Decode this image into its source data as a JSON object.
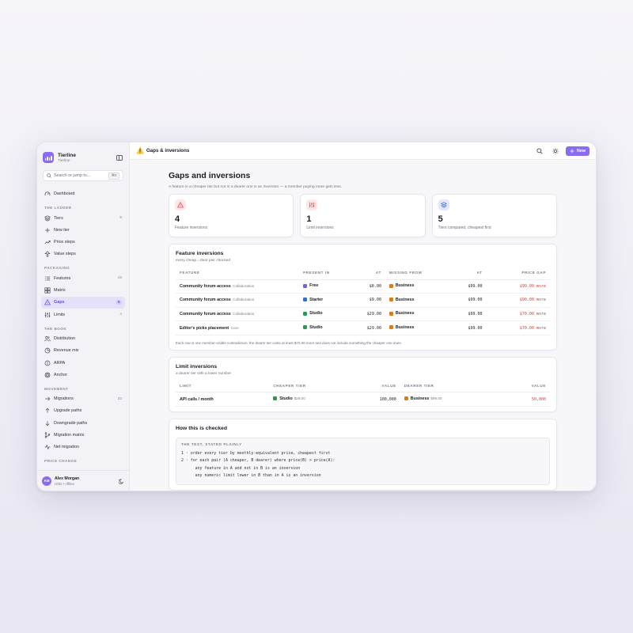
{
  "app": {
    "name": "Tierline",
    "sub": "Tierline"
  },
  "search": {
    "placeholder": "Search or jump to...",
    "shortcut": "⌘K"
  },
  "sidebar": {
    "dashboard": "Dashboard",
    "sections": {
      "ladder": "THE LADDER",
      "packaging": "PACKAGING",
      "book": "THE BOOK",
      "movement": "MOVEMENT",
      "price_change": "PRICE CHANGE"
    },
    "ladder": [
      {
        "label": "Tiers",
        "count": "5"
      },
      {
        "label": "New tier",
        "count": ""
      },
      {
        "label": "Price steps",
        "count": ""
      },
      {
        "label": "Value steps",
        "count": ""
      }
    ],
    "packaging": [
      {
        "label": "Features",
        "count": "15"
      },
      {
        "label": "Matrix",
        "count": ""
      },
      {
        "label": "Gaps",
        "count": "5"
      },
      {
        "label": "Limits",
        "count": "4"
      }
    ],
    "book": [
      {
        "label": "Distribution"
      },
      {
        "label": "Revenue mix"
      },
      {
        "label": "ARPA"
      },
      {
        "label": "Anchor"
      }
    ],
    "movement": [
      {
        "label": "Migrations",
        "count": "33"
      },
      {
        "label": "Upgrade paths",
        "count": ""
      },
      {
        "label": "Downgrade paths",
        "count": ""
      },
      {
        "label": "Migration matrix",
        "count": ""
      },
      {
        "label": "Net migration",
        "count": ""
      }
    ]
  },
  "user": {
    "initials": "AM",
    "name": "Alex Morgan",
    "sub": "USD • offline"
  },
  "topbar": {
    "breadcrumb": "Gaps & inversions",
    "new_label": "New"
  },
  "page": {
    "title": "Gaps and inversions",
    "subtitle": "A feature in a cheaper tier but not in a dearer one is an inversion — a member paying more gets less."
  },
  "stats": [
    {
      "value": "4",
      "label": "Feature inversions",
      "color": "#e5484d",
      "bg": "#fde8e8"
    },
    {
      "value": "1",
      "label": "Limit inversions",
      "color": "#e5484d",
      "bg": "#fde8e8"
    },
    {
      "value": "5",
      "label": "Tiers compared, cheapest first",
      "color": "#4c6fd8",
      "bg": "#e3e9fb"
    }
  ],
  "feature_inversions": {
    "title": "Feature inversions",
    "subtitle": "every cheap→dear pair checked",
    "columns": [
      "FEATURE",
      "PRESENT IN",
      "AT",
      "MISSING FROM",
      "AT",
      "PRICE GAP"
    ],
    "rows": [
      {
        "feature": "Community forum access",
        "category": "Collaboration",
        "present_in": "Free",
        "present_color": "#7c5ce8",
        "present_at": "$0.00",
        "missing_from": "Business",
        "missing_color": "#e07b14",
        "missing_at": "$99.00",
        "gap": "$99.00 more"
      },
      {
        "feature": "Community forum access",
        "category": "Collaboration",
        "present_in": "Starter",
        "present_color": "#2f6fd0",
        "present_at": "$9.00",
        "missing_from": "Business",
        "missing_color": "#e07b14",
        "missing_at": "$99.00",
        "gap": "$90.00 more"
      },
      {
        "feature": "Community forum access",
        "category": "Collaboration",
        "present_in": "Studio",
        "present_color": "#1f9d55",
        "present_at": "$29.00",
        "missing_from": "Business",
        "missing_color": "#e07b14",
        "missing_at": "$99.00",
        "gap": "$70.00 more"
      },
      {
        "feature": "Editor's picks placement",
        "category": "Core",
        "present_in": "Studio",
        "present_color": "#1f9d55",
        "present_at": "$29.00",
        "missing_from": "Business",
        "missing_color": "#e07b14",
        "missing_at": "$99.00",
        "gap": "$70.00 more"
      }
    ],
    "note": "Each row is one member-visible contradiction: the dearer tier costs at least $70.00 more and does not include something the cheaper one does."
  },
  "limit_inversions": {
    "title": "Limit inversions",
    "subtitle": "a dearer tier with a lower number",
    "columns": [
      "LIMIT",
      "CHEAPER TIER",
      "VALUE",
      "DEARER TIER",
      "VALUE"
    ],
    "rows": [
      {
        "limit": "API calls / month",
        "cheaper": "Studio",
        "cheaper_color": "#1f9d55",
        "cheaper_price": "$29.00",
        "cheaper_value": "100,000",
        "dearer": "Business",
        "dearer_color": "#e07b14",
        "dearer_price": "$99.00",
        "dearer_value": "50,000"
      }
    ]
  },
  "how_checked": {
    "title": "How this is checked",
    "head": "THE TEST, STATED PLAINLY",
    "lines": [
      "1 · order every tier by monthly-equivalent price, cheapest first",
      "2 · for each pair (A cheaper, B dearer) where price(B) > price(A):",
      "      any feature in A and not in B is an inversion",
      "      any numeric limit lower in B than in A is an inversion"
    ]
  }
}
